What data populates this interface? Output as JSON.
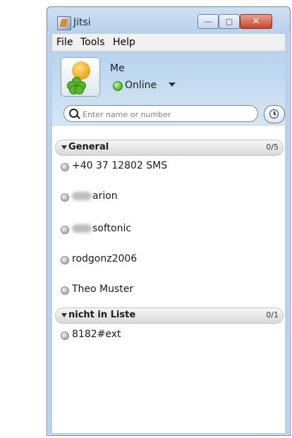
{
  "window": {
    "title": "Jitsi"
  },
  "menu": [
    "File",
    "Tools",
    "Help"
  ],
  "user": {
    "name": "Me",
    "status": "Online"
  },
  "search": {
    "placeholder": "Enter name or number"
  },
  "groups": [
    {
      "name": "General",
      "count": "0/5",
      "contacts": [
        "+40 37 12802 SMS",
        "arion",
        "softonic",
        "rodgonz2006",
        "Theo Muster"
      ]
    },
    {
      "name": "nicht in Liste",
      "count": "0/1",
      "contacts": [
        "8182#ext"
      ]
    }
  ],
  "colors": {
    "window_frame": "#b9d1ea",
    "online": "#3dbb14",
    "offline": "#a8a8a8"
  }
}
